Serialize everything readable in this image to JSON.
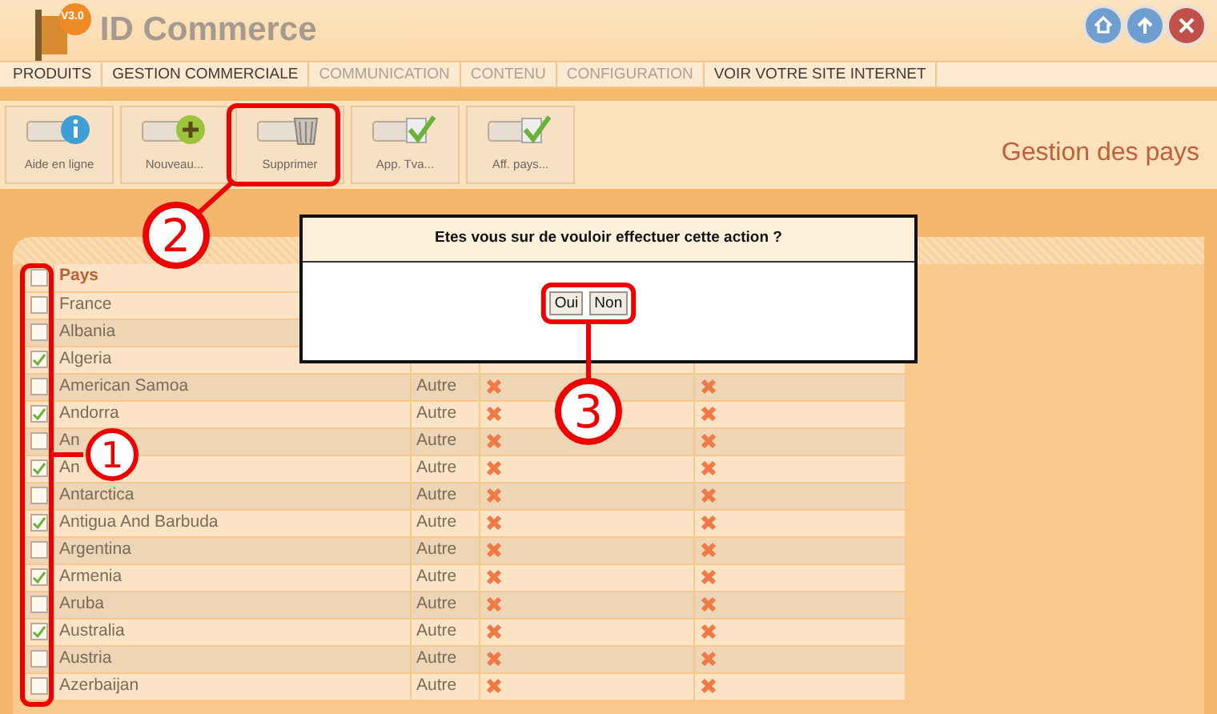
{
  "app": {
    "logo_badge": "V3.0",
    "title": "ID Commerce"
  },
  "header_buttons": [
    {
      "kind": "home"
    },
    {
      "kind": "up"
    },
    {
      "kind": "close"
    }
  ],
  "menu": [
    {
      "label": "PRODUITS",
      "disabled": false
    },
    {
      "label": "GESTION COMMERCIALE",
      "disabled": false
    },
    {
      "label": "COMMUNICATION",
      "disabled": true
    },
    {
      "label": "CONTENU",
      "disabled": true
    },
    {
      "label": "CONFIGURATION",
      "disabled": true
    },
    {
      "label": "VOIR VOTRE SITE INTERNET",
      "disabled": false
    }
  ],
  "toolbar": [
    {
      "label": "Aide en ligne",
      "kind": "info"
    },
    {
      "label": "Nouveau...",
      "kind": "plus"
    },
    {
      "label": "Supprimer",
      "kind": "trash"
    },
    {
      "label": "App. Tva...",
      "kind": "check"
    },
    {
      "label": "Aff. pays...",
      "kind": "check"
    }
  ],
  "page_title": "Gestion des pays",
  "table": {
    "columns": [
      "Pays"
    ],
    "header_checked": false,
    "rows": [
      {
        "name": "France",
        "checked": false
      },
      {
        "name": "Albania",
        "checked": false
      },
      {
        "name": "Algeria",
        "checked": true
      },
      {
        "name": "American Samoa",
        "checked": false,
        "type": "Autre",
        "flags": [
          false,
          false
        ]
      },
      {
        "name": "Andorra",
        "checked": true,
        "type": "Autre",
        "flags": [
          false,
          false
        ]
      },
      {
        "name": "An",
        "checked": false,
        "type": "Autre",
        "flags": [
          false,
          false
        ]
      },
      {
        "name": "An",
        "checked": true,
        "type": "Autre",
        "flags": [
          false,
          false
        ]
      },
      {
        "name": "Antarctica",
        "checked": false,
        "type": "Autre",
        "flags": [
          false,
          false
        ]
      },
      {
        "name": "Antigua And Barbuda",
        "checked": true,
        "type": "Autre",
        "flags": [
          false,
          false
        ]
      },
      {
        "name": "Argentina",
        "checked": false,
        "type": "Autre",
        "flags": [
          false,
          false
        ]
      },
      {
        "name": "Armenia",
        "checked": true,
        "type": "Autre",
        "flags": [
          false,
          false
        ]
      },
      {
        "name": "Aruba",
        "checked": false,
        "type": "Autre",
        "flags": [
          false,
          false
        ]
      },
      {
        "name": "Australia",
        "checked": true,
        "type": "Autre",
        "flags": [
          false,
          false
        ]
      },
      {
        "name": "Austria",
        "checked": false,
        "type": "Autre",
        "flags": [
          false,
          false
        ]
      },
      {
        "name": "Azerbaijan",
        "checked": false,
        "type": "Autre",
        "flags": [
          false,
          false
        ]
      }
    ]
  },
  "dialog": {
    "message": "Etes vous sur de vouloir effectuer cette action ?",
    "buttons": [
      "Oui",
      "Non"
    ]
  },
  "annotations": [
    {
      "number": "1"
    },
    {
      "number": "2"
    },
    {
      "number": "3"
    }
  ]
}
